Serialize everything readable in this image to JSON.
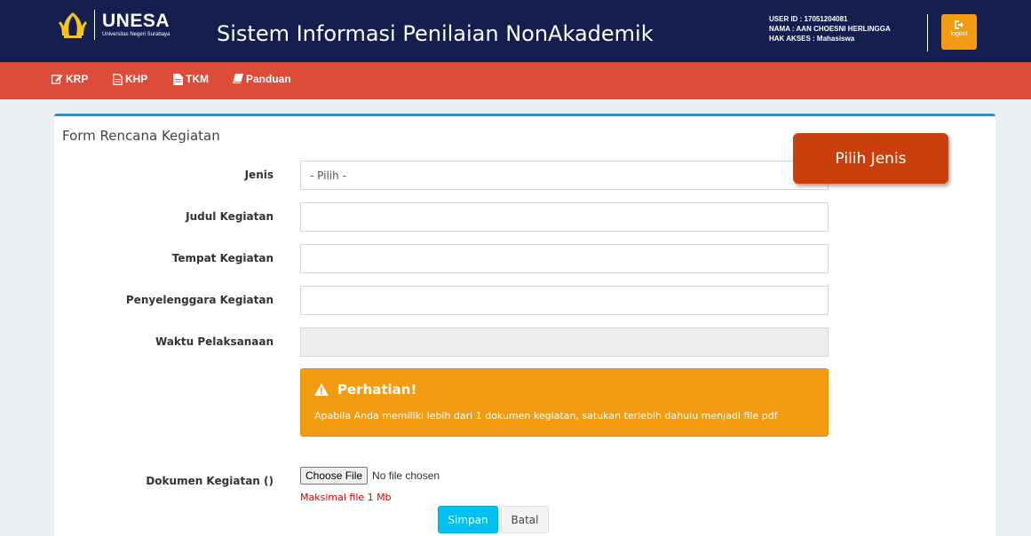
{
  "header": {
    "logo_text": "UNESA",
    "logo_subtext": "Universitas Negeri Surabaya",
    "app_title": "Sistem Informasi Penilaian NonAkademik",
    "user_id_line": "USER ID : 17051204081",
    "name_line": "NAMA : AAN CHOESNI HERLINGGA",
    "access_line": "HAK AKSES : Mahasiswa",
    "logout_label": "logout",
    "colors": {
      "header_bg": "#141e4f",
      "logout_bg": "#f39c12"
    }
  },
  "nav": {
    "items": [
      {
        "label": "KRP",
        "icon": "edit-icon"
      },
      {
        "label": "KHP",
        "icon": "file-text-icon"
      },
      {
        "label": "TKM",
        "icon": "file-icon"
      },
      {
        "label": "Panduan",
        "icon": "book-icon"
      }
    ],
    "bg": "#dd4b39"
  },
  "form": {
    "title": "Form Rencana Kegiatan",
    "jenis_label": "Jenis",
    "jenis_value": "- Pilih -",
    "judul_label": "Judul Kegiatan",
    "tempat_label": "Tempat Kegiatan",
    "penyelenggara_label": "Penyelenggara Kegiatan",
    "waktu_label": "Waktu Pelaksanaan",
    "dokumen_label": "Dokumen Kegiatan ()",
    "alert": {
      "title": "Perhatian!",
      "text": "Apabila Anda memiliki lebih dari 1 dokumen kegiatan, satukan terlebih dahulu menjadi file pdf",
      "bg": "#f39c12"
    },
    "file_button": "Choose File",
    "file_status": "No file chosen",
    "file_hint": "Maksimal file 1 Mb",
    "save_label": "Simpan",
    "cancel_label": "Batal"
  },
  "callout": {
    "text": "Pilih Jenis",
    "bg": "#c9400c"
  }
}
